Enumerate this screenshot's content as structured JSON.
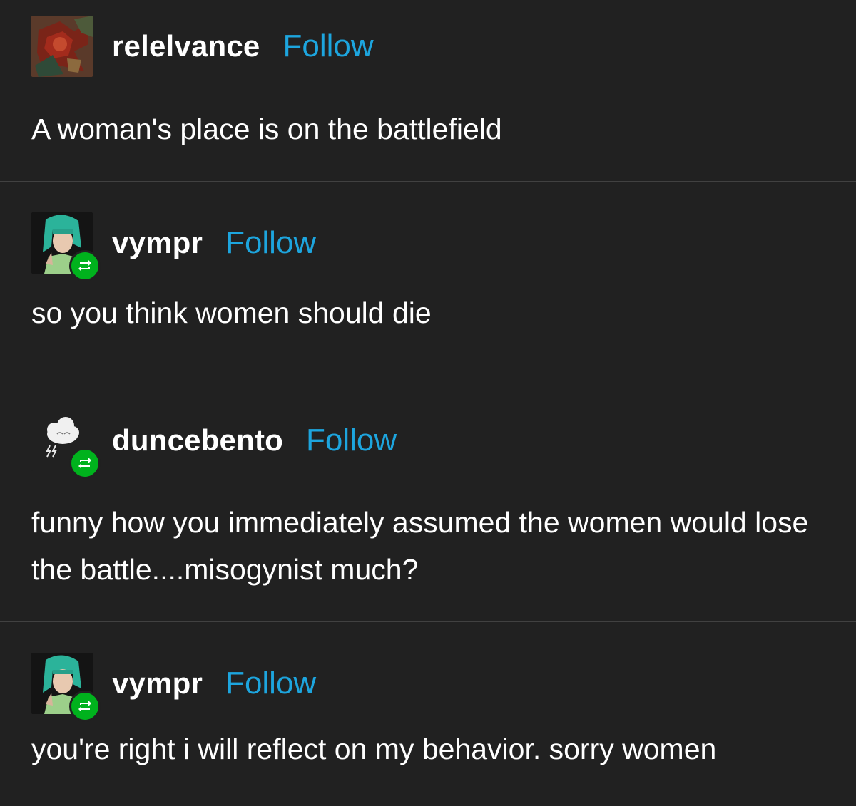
{
  "posts": [
    {
      "username": "relelvance",
      "follow_label": "Follow",
      "text": "A woman's place is on the battlefield",
      "avatar_icon": "red-artwork-avatar",
      "reblog": false
    },
    {
      "username": "vympr",
      "follow_label": "Follow",
      "text": "so you think women should die",
      "avatar_icon": "teal-hair-avatar",
      "reblog": true
    },
    {
      "username": "duncebento",
      "follow_label": "Follow",
      "text": "funny how you immediately assumed the women would lose the battle....misogynist much?",
      "avatar_icon": "storm-cloud-avatar",
      "reblog": true
    },
    {
      "username": "vympr",
      "follow_label": "Follow",
      "text": "you're right i will reflect on my behavior. sorry women",
      "avatar_icon": "teal-hair-avatar",
      "reblog": true
    }
  ],
  "colors": {
    "background": "#212121",
    "divider": "#414141",
    "follow_link": "#1da5de",
    "reblog_badge": "#00b21d",
    "text": "#ffffff"
  }
}
